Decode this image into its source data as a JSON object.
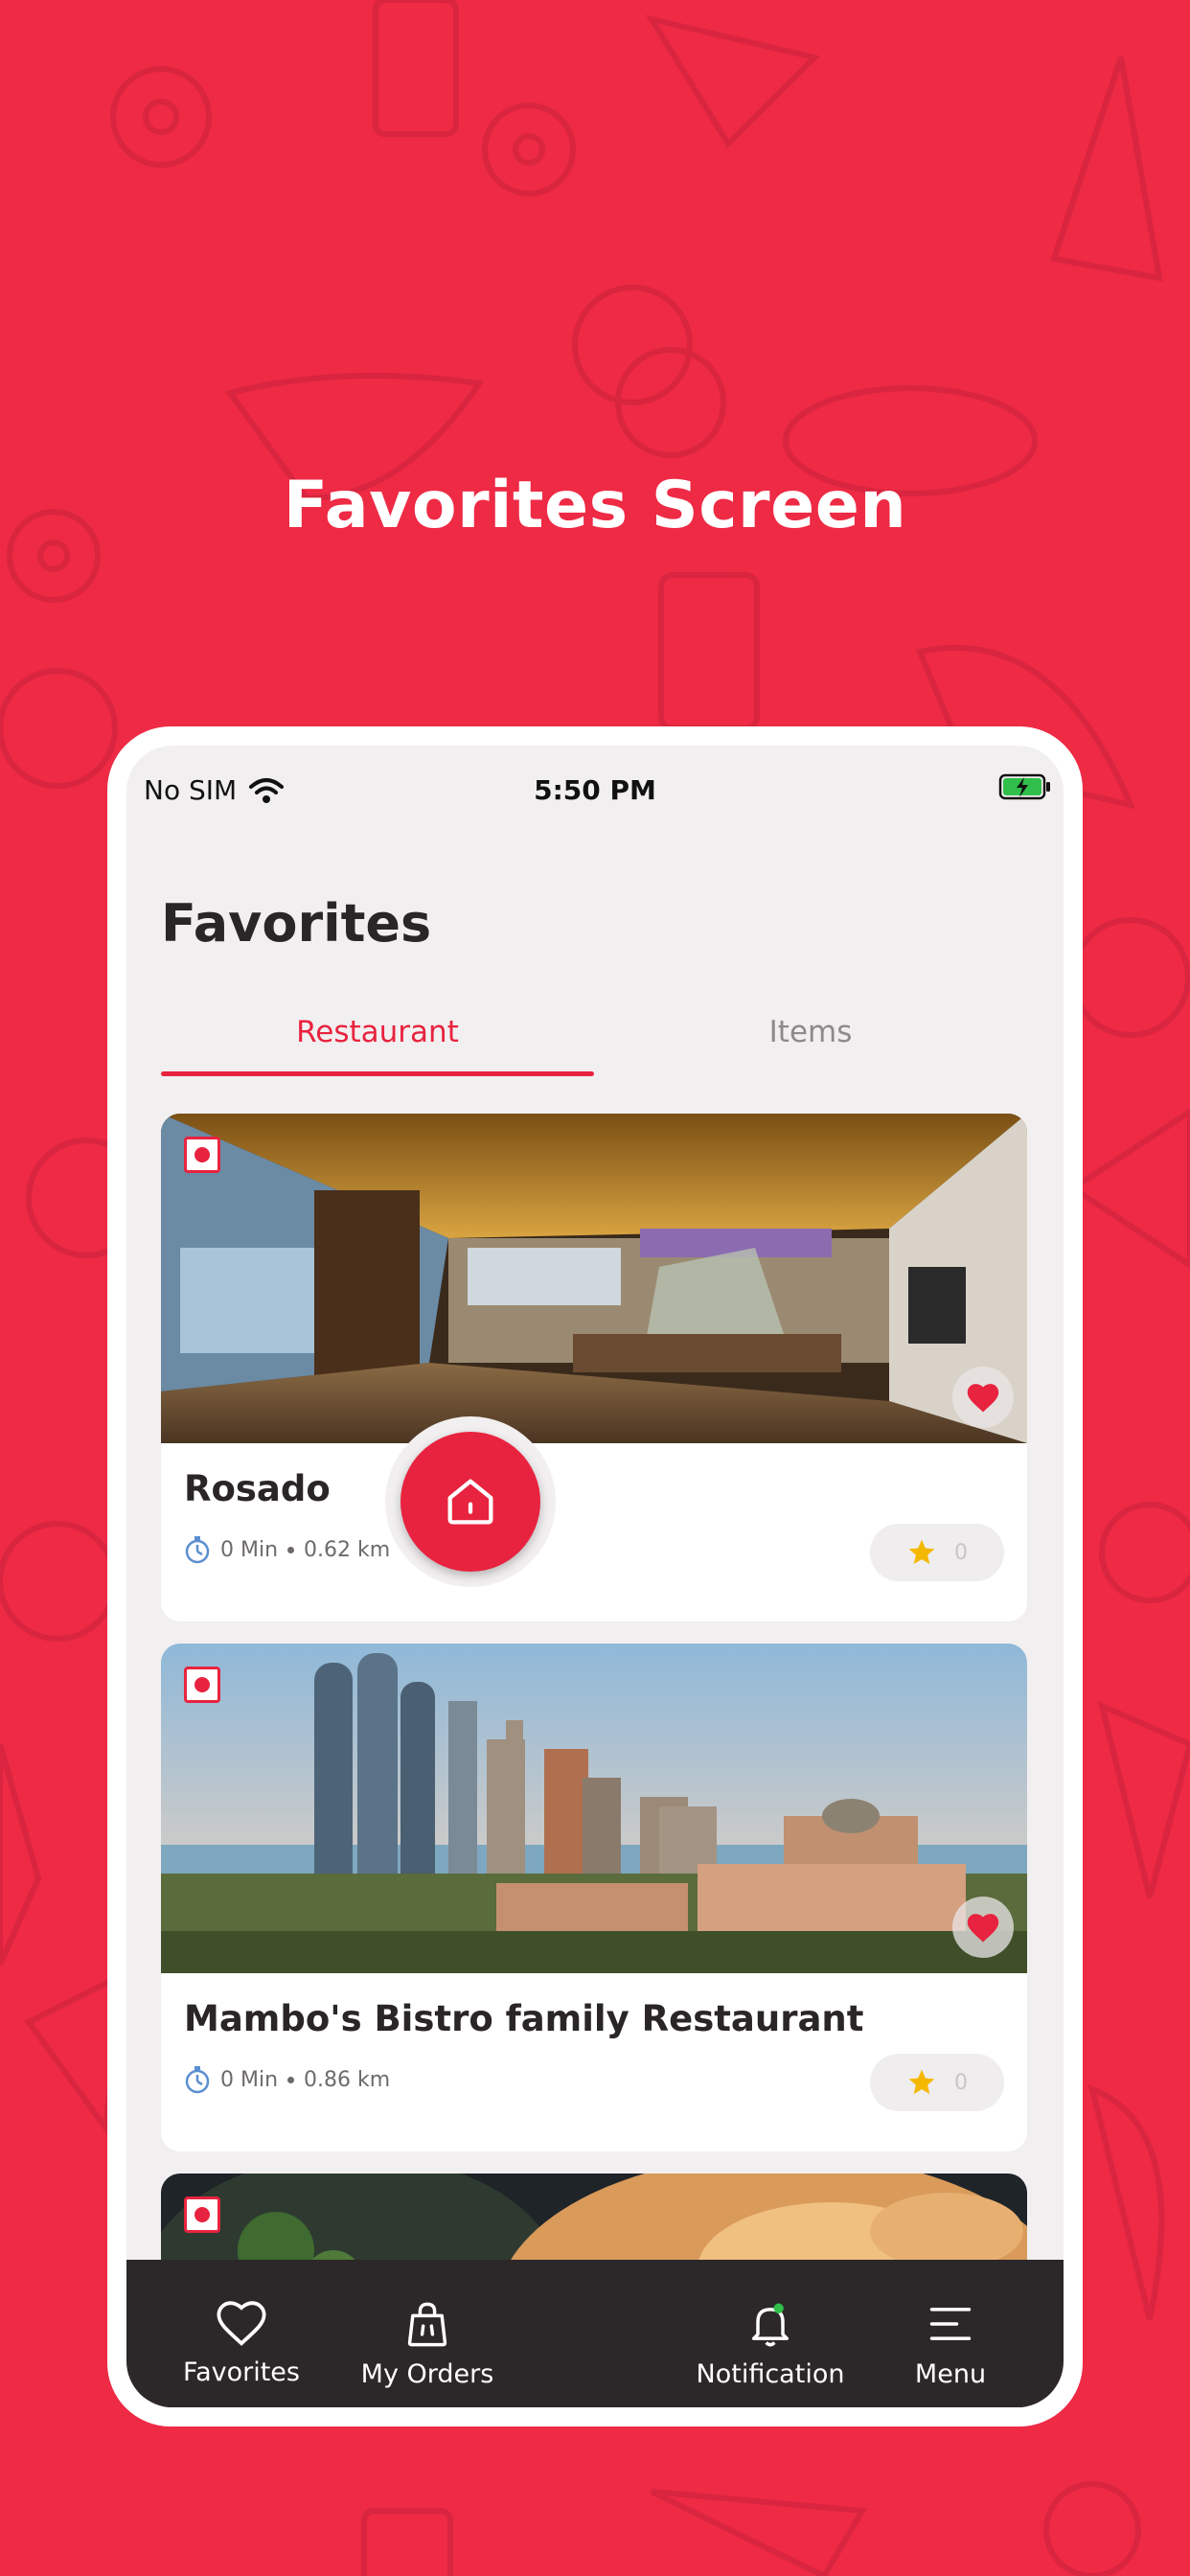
{
  "hero": {
    "title": "Favorites Screen"
  },
  "status_bar": {
    "carrier": "No SIM",
    "time": "5:50 PM"
  },
  "page": {
    "title": "Favorites"
  },
  "tabs": [
    {
      "label": "Restaurant",
      "active": true
    },
    {
      "label": "Items",
      "active": false
    }
  ],
  "restaurants": [
    {
      "name": "Rosado",
      "time": "0 Min",
      "distance": "0.62 km",
      "rating": "0",
      "favorite": true
    },
    {
      "name": "Mambo's Bistro family Restaurant",
      "time": "0 Min",
      "distance": "0.86 km",
      "rating": "0",
      "favorite": true
    },
    {
      "name": "",
      "favorite": true
    }
  ],
  "bottom_nav": {
    "items": [
      {
        "label": "Favorites",
        "icon": "heart-icon"
      },
      {
        "label": "My Orders",
        "icon": "shopping-bag-icon"
      },
      {
        "label": "Notification",
        "icon": "bell-icon"
      },
      {
        "label": "Menu",
        "icon": "menu-icon"
      }
    ],
    "center": {
      "icon": "home-icon"
    }
  },
  "colors": {
    "brand": "#ee2a45",
    "accent": "#e8233f",
    "nav_bg": "#2c2728",
    "star": "#f5b800",
    "battery": "#2fbf4a"
  }
}
